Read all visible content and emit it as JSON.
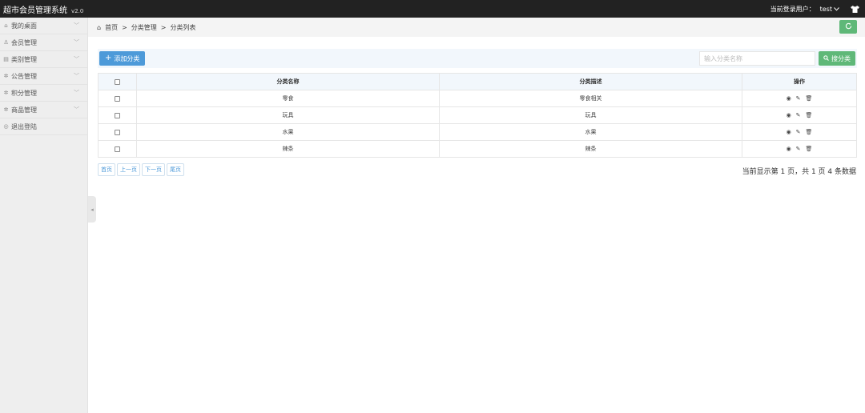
{
  "app": {
    "title": "超市会员管理系统",
    "version": "v2.0"
  },
  "header": {
    "login_label": "当前登录用户：",
    "username": "test"
  },
  "sidebar": {
    "items": [
      {
        "label": "我的桌面",
        "icon": "home-icon"
      },
      {
        "label": "会员管理",
        "icon": "user-icon"
      },
      {
        "label": "类别管理",
        "icon": "list-icon"
      },
      {
        "label": "公告管理",
        "icon": "gear-icon"
      },
      {
        "label": "积分管理",
        "icon": "gear-icon"
      },
      {
        "label": "商品管理",
        "icon": "gear-icon"
      },
      {
        "label": "退出登陆",
        "icon": "circle-icon"
      }
    ]
  },
  "breadcrumb": {
    "home": "首页",
    "sep": ">",
    "level1": "分类管理",
    "level2": "分类列表"
  },
  "toolbar": {
    "add_label": "添加分类",
    "search_placeholder": "输入分类名称",
    "search_label": "搜分类"
  },
  "table": {
    "headers": {
      "name": "分类名称",
      "desc": "分类描述",
      "ops": "操作"
    },
    "rows": [
      {
        "name": "零食",
        "desc": "零食相关"
      },
      {
        "name": "玩具",
        "desc": "玩具"
      },
      {
        "name": "水果",
        "desc": "水果"
      },
      {
        "name": "辣条",
        "desc": "辣条"
      }
    ]
  },
  "pager": {
    "first": "首页",
    "prev": "上一页",
    "next": "下一页",
    "last": "尾页",
    "info": "当前显示第 1 页，共 1 页 4 条数据"
  },
  "colors": {
    "topbar": "#222222",
    "primary": "#4d9ad9",
    "success": "#5fb878"
  }
}
